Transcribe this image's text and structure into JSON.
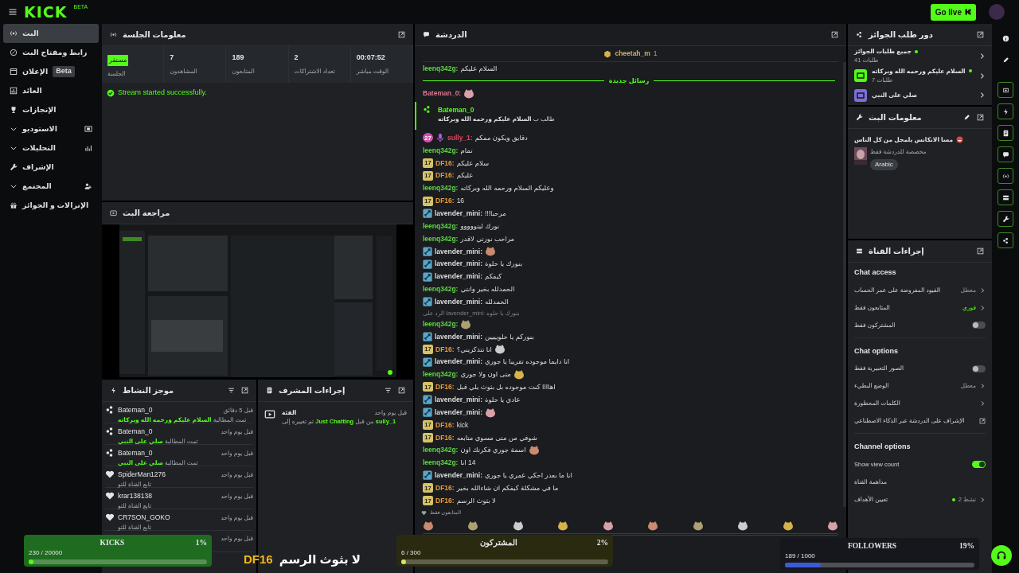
{
  "topbar": {
    "logo": "KICK",
    "logo_tag": "BETA",
    "go_live": "Go live"
  },
  "sidebar": {
    "items": [
      {
        "label": "البث",
        "selected": true,
        "expandable": false
      },
      {
        "label": "رابط ومفتاح البث",
        "selected": false,
        "expandable": false
      },
      {
        "label": "الإعلان",
        "selected": false,
        "expandable": false,
        "badge": "Beta"
      },
      {
        "label": "العائد",
        "selected": false,
        "expandable": false
      },
      {
        "label": "الإنجازات",
        "selected": false,
        "expandable": false
      },
      {
        "label": "الاستوديو",
        "selected": false,
        "expandable": true
      },
      {
        "label": "التحليلات",
        "selected": false,
        "expandable": true
      },
      {
        "label": "الإشراف",
        "selected": false,
        "expandable": false
      },
      {
        "label": "المجتمع",
        "selected": false,
        "expandable": true
      },
      {
        "label": "الإنزالات و الجوائز",
        "selected": false,
        "expandable": false
      }
    ]
  },
  "session": {
    "title": "معلومات الجلسة",
    "stats": [
      {
        "kind": "number",
        "value": "00:07:52",
        "label": "الوقت مباشر"
      },
      {
        "kind": "number",
        "value": "2",
        "label": "تعداد الاشتراكات"
      },
      {
        "kind": "number",
        "value": "189",
        "label": "المتابعون"
      },
      {
        "kind": "number",
        "value": "7",
        "label": "المشاهدون"
      },
      {
        "kind": "badge",
        "value": "مستقر",
        "label": "الجلسة"
      }
    ],
    "alert": "Stream started successfully."
  },
  "preview": {
    "title": "مراجعة البث",
    "kind": "picture"
  },
  "activity": {
    "title": "موجز النشاط",
    "items": [
      {
        "kind": "claim",
        "user": "Bateman_0",
        "action": "تمت المطالبة",
        "reward": "السلام عليكم ورحمه الله وبركاته",
        "time": "قبل 5 دقائق"
      },
      {
        "kind": "claim",
        "user": "Bateman_0",
        "action": "تمت المطالبة",
        "reward": "صلي على النبي",
        "time": "قبل يوم واحد"
      },
      {
        "kind": "claim",
        "user": "Bateman_0",
        "action": "تمت المطالبة",
        "reward": "صلي على النبي",
        "time": "قبل يوم واحد"
      },
      {
        "kind": "follow",
        "user": "SpiderMan1276",
        "action": "تابع القناة للتو",
        "time": "قبل يوم واحد"
      },
      {
        "kind": "follow",
        "user": "krar138138",
        "action": "تابع القناة للتو",
        "time": "قبل يوم واحد"
      },
      {
        "kind": "follow",
        "user": "CR7SON_GOKO",
        "action": "تابع القناة للتو",
        "time": "قبل يوم واحد"
      },
      {
        "time": "قبل يوم واحد"
      }
    ]
  },
  "mod_actions": {
    "title": "إجراءات المشرف",
    "items": [
      {
        "title": "الفئة",
        "parts": [
          {
            "text": "sully_1",
            "highlight": true
          },
          {
            "text": "من قبل",
            "highlight": false
          },
          {
            "text": "Just Chatting",
            "highlight": true
          },
          {
            "text": "تم تغييره إلى",
            "highlight": false
          }
        ],
        "time": "قبل يوم واحد"
      }
    ]
  },
  "chat": {
    "title": "الدردشة",
    "pinned": {
      "user": "cheetah_m",
      "count": "1"
    },
    "messages": [
      {
        "kind": "message",
        "user": "leenq342g:",
        "color": "#5fd447",
        "text": "السلام عليكم"
      },
      {
        "kind": "divider",
        "text": "رسائل جديدة"
      },
      {
        "kind": "message",
        "user": "Bateman_0:",
        "color": "#d9788f",
        "emote": true
      },
      {
        "kind": "reward",
        "user": "Bateman_0",
        "text": "طالب ب **السلام عليكم ورحمه الله وبركاته**"
      },
      {
        "kind": "message",
        "user": "sully_1:",
        "color": "#e2455f",
        "badges": [
          {
            "kind": "gifter",
            "text": "27"
          },
          {
            "kind": "mic"
          }
        ],
        "text": "دقايق ويكون ممكم"
      },
      {
        "kind": "message",
        "user": "leenq342g:",
        "color": "#5fd447",
        "text": "تمام"
      },
      {
        "kind": "message",
        "user": "DF16:",
        "color": "#e59a3a",
        "badges": [
          {
            "kind": "sub",
            "text": "17"
          }
        ],
        "text": "سلام عليكم"
      },
      {
        "kind": "message",
        "user": "DF16:",
        "color": "#e59a3a",
        "badges": [
          {
            "kind": "sub",
            "text": "17"
          }
        ],
        "text": "عليكم"
      },
      {
        "kind": "message",
        "user": "leenq342g:",
        "color": "#5fd447",
        "text": "وعليكم السلام ورحمه الله وبركاته"
      },
      {
        "kind": "message",
        "user": "DF16:",
        "color": "#e59a3a",
        "badges": [
          {
            "kind": "sub",
            "text": "17"
          }
        ],
        "text": "16"
      },
      {
        "kind": "message",
        "user": "lavender_mini:",
        "color": "#dcdcdc",
        "badges": [
          {
            "kind": "mod"
          }
        ],
        "text": "مرحبا!!!"
      },
      {
        "kind": "message",
        "user": "leenq342g:",
        "color": "#5fd447",
        "text": "نورك ليتووووو"
      },
      {
        "kind": "message",
        "user": "leenq342g:",
        "color": "#5fd447",
        "text": "مراحب نورتي لاقدر"
      },
      {
        "kind": "message",
        "user": "lavender_mini:",
        "color": "#dcdcdc",
        "badges": [
          {
            "kind": "mod"
          }
        ],
        "emote": true
      },
      {
        "kind": "message",
        "user": "lavender_mini:",
        "color": "#dcdcdc",
        "badges": [
          {
            "kind": "mod"
          }
        ],
        "text": "بنورك يا حلوة"
      },
      {
        "kind": "message",
        "user": "lavender_mini:",
        "color": "#dcdcdc",
        "badges": [
          {
            "kind": "mod"
          }
        ],
        "text": "كيفكم"
      },
      {
        "kind": "message",
        "user": "leenq342g:",
        "color": "#5fd447",
        "text": "الحمدلله بخير وانتي"
      },
      {
        "kind": "message",
        "user": "lavender_mini:",
        "color": "#dcdcdc",
        "badges": [
          {
            "kind": "mod"
          }
        ],
        "text": "الحمدلله"
      },
      {
        "kind": "reply",
        "text": "الرد على lavender_mini: بنورك يا حلوه"
      },
      {
        "kind": "message",
        "user": "leenq342g:",
        "color": "#5fd447",
        "emote": true
      },
      {
        "kind": "message",
        "user": "lavender_mini:",
        "color": "#dcdcdc",
        "badges": [
          {
            "kind": "mod"
          }
        ],
        "text": "بنوركم يا حلويييين"
      },
      {
        "kind": "message",
        "user": "DF16:",
        "color": "#e59a3a",
        "badges": [
          {
            "kind": "sub",
            "text": "17"
          }
        ],
        "text": "انا تتذكريني؟",
        "emote": true
      },
      {
        "kind": "message",
        "user": "lavender_mini:",
        "color": "#dcdcdc",
        "badges": [
          {
            "kind": "mod"
          }
        ],
        "text": "انا دايما موجوده تقريبا يا جوري"
      },
      {
        "kind": "message",
        "user": "leenq342g:",
        "color": "#5fd447",
        "text": "متى اون ولا جوري",
        "emote": true
      },
      {
        "kind": "message",
        "user": "DF16:",
        "color": "#e59a3a",
        "badges": [
          {
            "kind": "sub",
            "text": "17"
          }
        ],
        "text": "اهاااا كنت موجوده بل بثوث يلي قبل"
      },
      {
        "kind": "message",
        "user": "lavender_mini:",
        "color": "#dcdcdc",
        "badges": [
          {
            "kind": "mod"
          }
        ],
        "text": "عادي يا حلوة"
      },
      {
        "kind": "message",
        "user": "lavender_mini:",
        "color": "#dcdcdc",
        "badges": [
          {
            "kind": "mod"
          }
        ],
        "emote": true
      },
      {
        "kind": "message",
        "user": "DF16:",
        "color": "#e59a3a",
        "badges": [
          {
            "kind": "sub",
            "text": "17"
          }
        ],
        "text": "kick"
      },
      {
        "kind": "message",
        "user": "DF16:",
        "color": "#e59a3a",
        "badges": [
          {
            "kind": "sub",
            "text": "17"
          }
        ],
        "text": "شوفي من متى مسوي متابعه"
      },
      {
        "kind": "message",
        "user": "leenq342g:",
        "color": "#5fd447",
        "text": "اسمة جوري فكرتك اون",
        "emote": true
      },
      {
        "kind": "message",
        "user": "leenq342g:",
        "color": "#5fd447",
        "text": "14 انا"
      },
      {
        "kind": "message",
        "user": "lavender_mini:",
        "color": "#dcdcdc",
        "badges": [
          {
            "kind": "mod"
          }
        ],
        "text": "انا ما بعدر احكي عمري يا جوري"
      },
      {
        "kind": "message",
        "user": "DF16:",
        "color": "#e59a3a",
        "badges": [
          {
            "kind": "sub",
            "text": "17"
          }
        ],
        "text": "ما في مشكلة كيفكم ان شاءالله بخير"
      },
      {
        "kind": "message",
        "user": "DF16:",
        "color": "#e59a3a",
        "badges": [
          {
            "kind": "sub",
            "text": "17"
          }
        ],
        "text": "لا بثوث الرسم"
      }
    ],
    "mode": "المتابعون فقط"
  },
  "reward_queue": {
    "title": "دور طلب الجوائز",
    "items": [
      {
        "kind": "all",
        "title": "جميع طلبات الجوائز",
        "count": "طلبات 41",
        "active": true
      },
      {
        "kind": "reward",
        "title": "السلام عليكم ورحمه الله وبركاته",
        "count": "طلبات 7",
        "active": true,
        "color": "#53fc18"
      },
      {
        "kind": "reward",
        "title": "صلي على النبي",
        "active": false,
        "color": "#7b6fd6"
      }
    ]
  },
  "stream_info": {
    "title": "معلومات البث",
    "stream_title": "مسا الانكانس يلمجل من كل الناس",
    "category": "مخصصة للدردشة فقط",
    "tags": [
      "Arabic"
    ]
  },
  "channel_actions": {
    "title": "إجراءات القناة",
    "sections": [
      {
        "title": "Chat access",
        "rows": [
          {
            "kind": "value",
            "label": "القيود المفروضة على عمر الحساب",
            "value": "معطل",
            "highlight": false
          },
          {
            "kind": "value",
            "label": "المتابعون فقط",
            "value": "فوري",
            "highlight": true
          },
          {
            "kind": "toggle",
            "label": "المشتركون فقط",
            "on": false
          }
        ]
      },
      {
        "title": "Chat options",
        "rows": [
          {
            "kind": "toggle",
            "label": "الصور التعبيرية فقط",
            "on": false
          },
          {
            "kind": "value",
            "label": "الوضع البطيء",
            "value": "معطل",
            "highlight": false
          },
          {
            "kind": "value",
            "label": "الكلمات المحظورة"
          },
          {
            "kind": "external",
            "label": "الإشراف على الدردشة عبر الذكاء الاصطناعي"
          }
        ]
      },
      {
        "title": "Channel options",
        "rows": [
          {
            "kind": "toggle",
            "label": "Show view count",
            "on": true
          },
          {
            "kind": "plain",
            "label": "مداهمة القناة"
          },
          {
            "kind": "status",
            "label": "تعيين الأهداف",
            "value": "2 نشط"
          }
        ]
      }
    ]
  },
  "rail": {
    "items": [
      {
        "active": false
      },
      {
        "active": false
      },
      {
        "active": true
      },
      {
        "active": true
      },
      {
        "active": true
      },
      {
        "active": true
      },
      {
        "active": true
      },
      {
        "active": true
      },
      {
        "active": true
      },
      {
        "active": true
      }
    ]
  },
  "goals": [
    {
      "kind": "followers",
      "title": "FOLLOWERS",
      "percent": "19%",
      "progress": "189 / 1000",
      "level": 0.19
    },
    {
      "kind": "subs",
      "title": "المشتركون",
      "percent": "2%",
      "progress": "6 / 300",
      "level": 0.02
    },
    {
      "kind": "kicks",
      "title": "KICKS",
      "percent": "1%",
      "progress": "230 / 20000",
      "level": 0.01
    }
  ],
  "caption": {
    "user": "DF16",
    "text": "لا بثوث الرسم"
  }
}
